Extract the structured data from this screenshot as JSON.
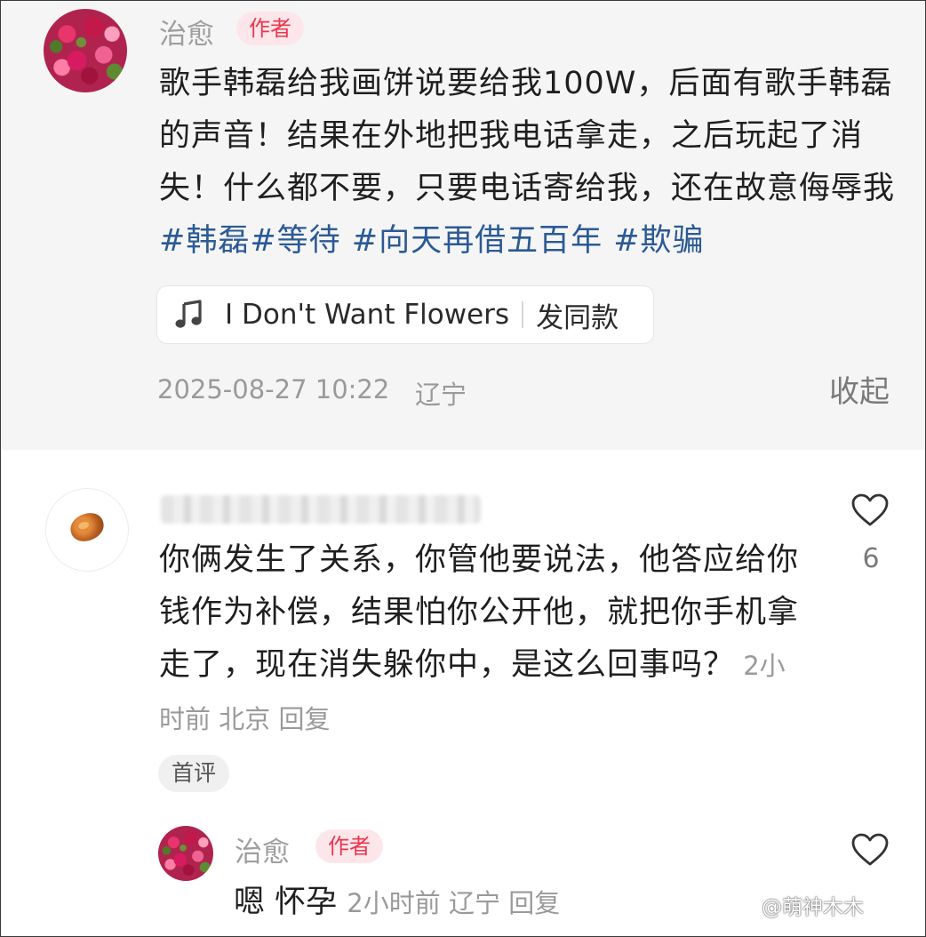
{
  "post": {
    "username": "治愈",
    "author_badge": "作者",
    "text_plain": "歌手韩磊给我画饼说要给我100W，后面有歌手韩磊的声音！结果在外地把我电话拿走，之后玩起了消失！什么都不要，只要电话寄给我，还在故意侮辱我",
    "tags": [
      "#韩磊",
      "#等待 ",
      "#向天再借五百年 ",
      "#欺骗"
    ],
    "music": {
      "icon": "music-note-icon",
      "title": "I Don't Want Flowers",
      "action": "发同款"
    },
    "timestamp": "2025-08-27 10:22",
    "location": "辽宁",
    "collapse_label": "收起"
  },
  "comment": {
    "username_hidden": "",
    "text": "你俩发生了关系，你管他要说法，他答应给你钱作为补偿，结果怕你公开他，就把你手机拿走了，现在消失躲你中，是这么回事吗？",
    "meta_time": "2小时前",
    "meta_location": "北京",
    "reply_label": "回复",
    "like_icon": "heart-outline-icon",
    "like_count": "6",
    "badge": "首评"
  },
  "reply": {
    "username": "治愈",
    "author_badge": "作者",
    "text": "嗯 怀孕",
    "meta_time": "2小时前",
    "meta_location": "辽宁",
    "reply_label": "回复",
    "like_icon": "heart-outline-icon"
  },
  "watermark": "@萌神木木",
  "colors": {
    "author_badge_bg": "#fde6ea",
    "author_badge_text": "#e8384f",
    "hashtag": "#2b5a94",
    "post_bg": "#f5f5f5"
  }
}
